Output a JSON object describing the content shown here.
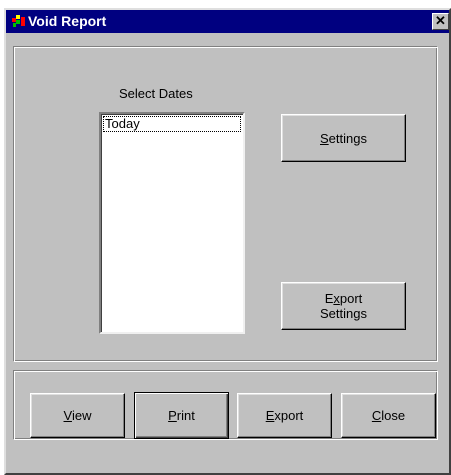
{
  "window": {
    "title": "Void Report",
    "close_glyph": "✕"
  },
  "icons": {
    "app": "report-app-icon",
    "close": "close-icon"
  },
  "dates": {
    "label": "Select Dates",
    "items": [
      "Today"
    ],
    "selected": "Today"
  },
  "buttons": {
    "settings": {
      "access": "S",
      "rest": "ettings"
    },
    "export_settings": {
      "line1_access": "x",
      "line1_pre": "E",
      "line1_post": "port",
      "line2": "Settings"
    },
    "view": {
      "access": "V",
      "rest": "iew"
    },
    "print": {
      "access": "P",
      "rest": "rint"
    },
    "export": {
      "access": "E",
      "rest": "xport"
    },
    "close": {
      "access": "C",
      "rest": "lose"
    }
  },
  "colors": {
    "title_bar": "#000080",
    "face": "#c0c0c0",
    "icon_red": "#ff0000",
    "icon_green": "#00c000",
    "icon_yellow": "#ffff00"
  }
}
